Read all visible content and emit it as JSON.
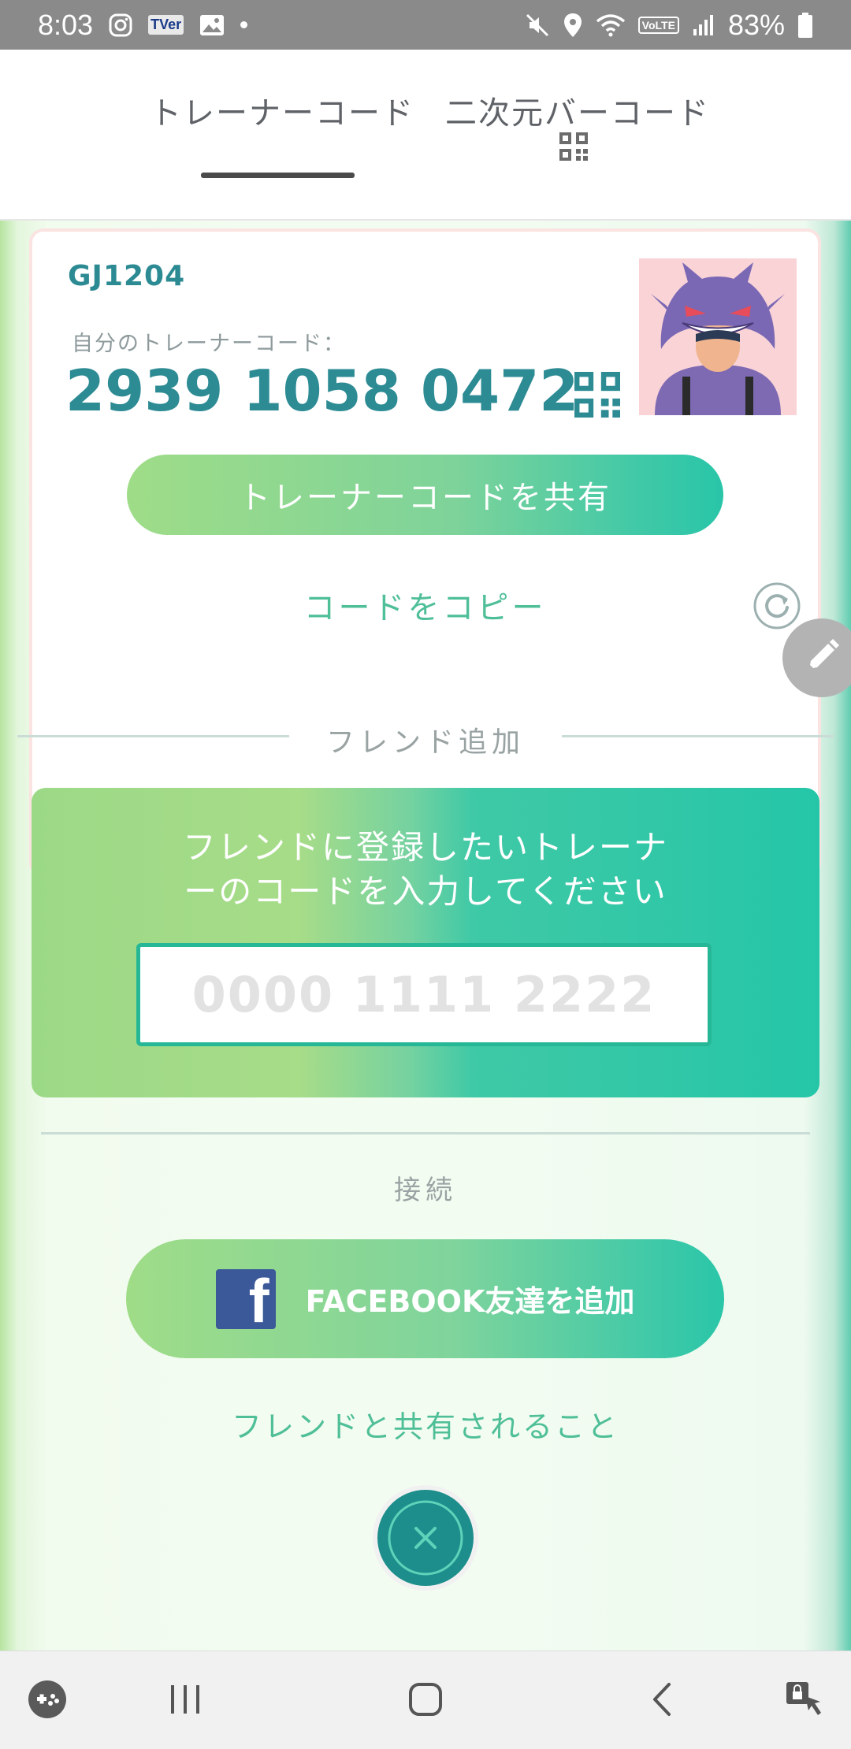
{
  "status_bar": {
    "time": "8:03",
    "battery": "83%",
    "app_badge": "TVer",
    "volte": "VoLTE"
  },
  "tabs": [
    {
      "label": "トレーナーコード",
      "selected": true
    },
    {
      "label": "二次元バーコード",
      "selected": false
    }
  ],
  "trainer_card": {
    "name": "GJ1204",
    "code_label": "自分のトレーナーコード：",
    "code": "2939 1058 0472",
    "share_button": "トレーナーコードを共有",
    "copy_link": "コードをコピー"
  },
  "friend_add": {
    "section_label": "フレンド追加",
    "instruction_line1": "フレンドに登録したいトレーナ",
    "instruction_line2": "ーのコードを入力してください",
    "input_placeholder": "0000 1111 2222",
    "input_value": ""
  },
  "connect": {
    "section_label": "接続",
    "facebook_button": "FACEBOOK友達を追加",
    "share_info_link": "フレンドと共有されること"
  },
  "colors": {
    "accent_teal": "#2d8b94",
    "link_green": "#4fbf98",
    "gradient_start": "#9fdc88",
    "gradient_end": "#29c5a8",
    "facebook_blue": "#3b5998",
    "close_button": "#1d8e8c"
  },
  "icons": {
    "tab_qr": "qr-code-icon",
    "card_qr": "qr-code-icon",
    "refresh": "refresh-icon",
    "edit": "pencil-icon",
    "close": "close-icon",
    "facebook": "facebook-logo-icon"
  }
}
